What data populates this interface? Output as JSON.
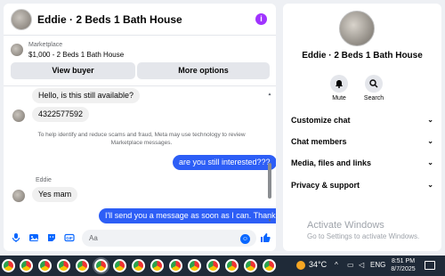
{
  "chat": {
    "title": "Eddie · 2 Beds 1 Bath House",
    "listing": {
      "category": "Marketplace",
      "subtitle": "$1,000 - 2 Beds 1 Bath House",
      "view_buyer_label": "View buyer",
      "more_options_label": "More options"
    },
    "messages": {
      "in_1": "Hello, is this still available?",
      "in_2": "4322577592",
      "notice": "To help identify and reduce scams and fraud, Meta may use technology to review Marketplace messages.",
      "out_1": "are you still interested???",
      "sender": "Eddie",
      "in_3": "Yes mam",
      "out_2": "I'll send you a message as soon as I can. Thanks"
    },
    "composer": {
      "placeholder": "Aa"
    },
    "accent_color": "#0866ff",
    "outgoing_bubble_color": "#2d5ef6"
  },
  "info_panel": {
    "title": "Eddie · 2 Beds 1 Bath House",
    "mute_label": "Mute",
    "search_label": "Search",
    "sections": [
      "Customize chat",
      "Chat members",
      "Media, files and links",
      "Privacy & support"
    ],
    "watermark_title": "Activate Windows",
    "watermark_sub": "Go to Settings to activate Windows."
  },
  "taskbar": {
    "temperature": "34°C",
    "language": "ENG",
    "time": "8:51 PM",
    "date": "8/7/2025"
  }
}
